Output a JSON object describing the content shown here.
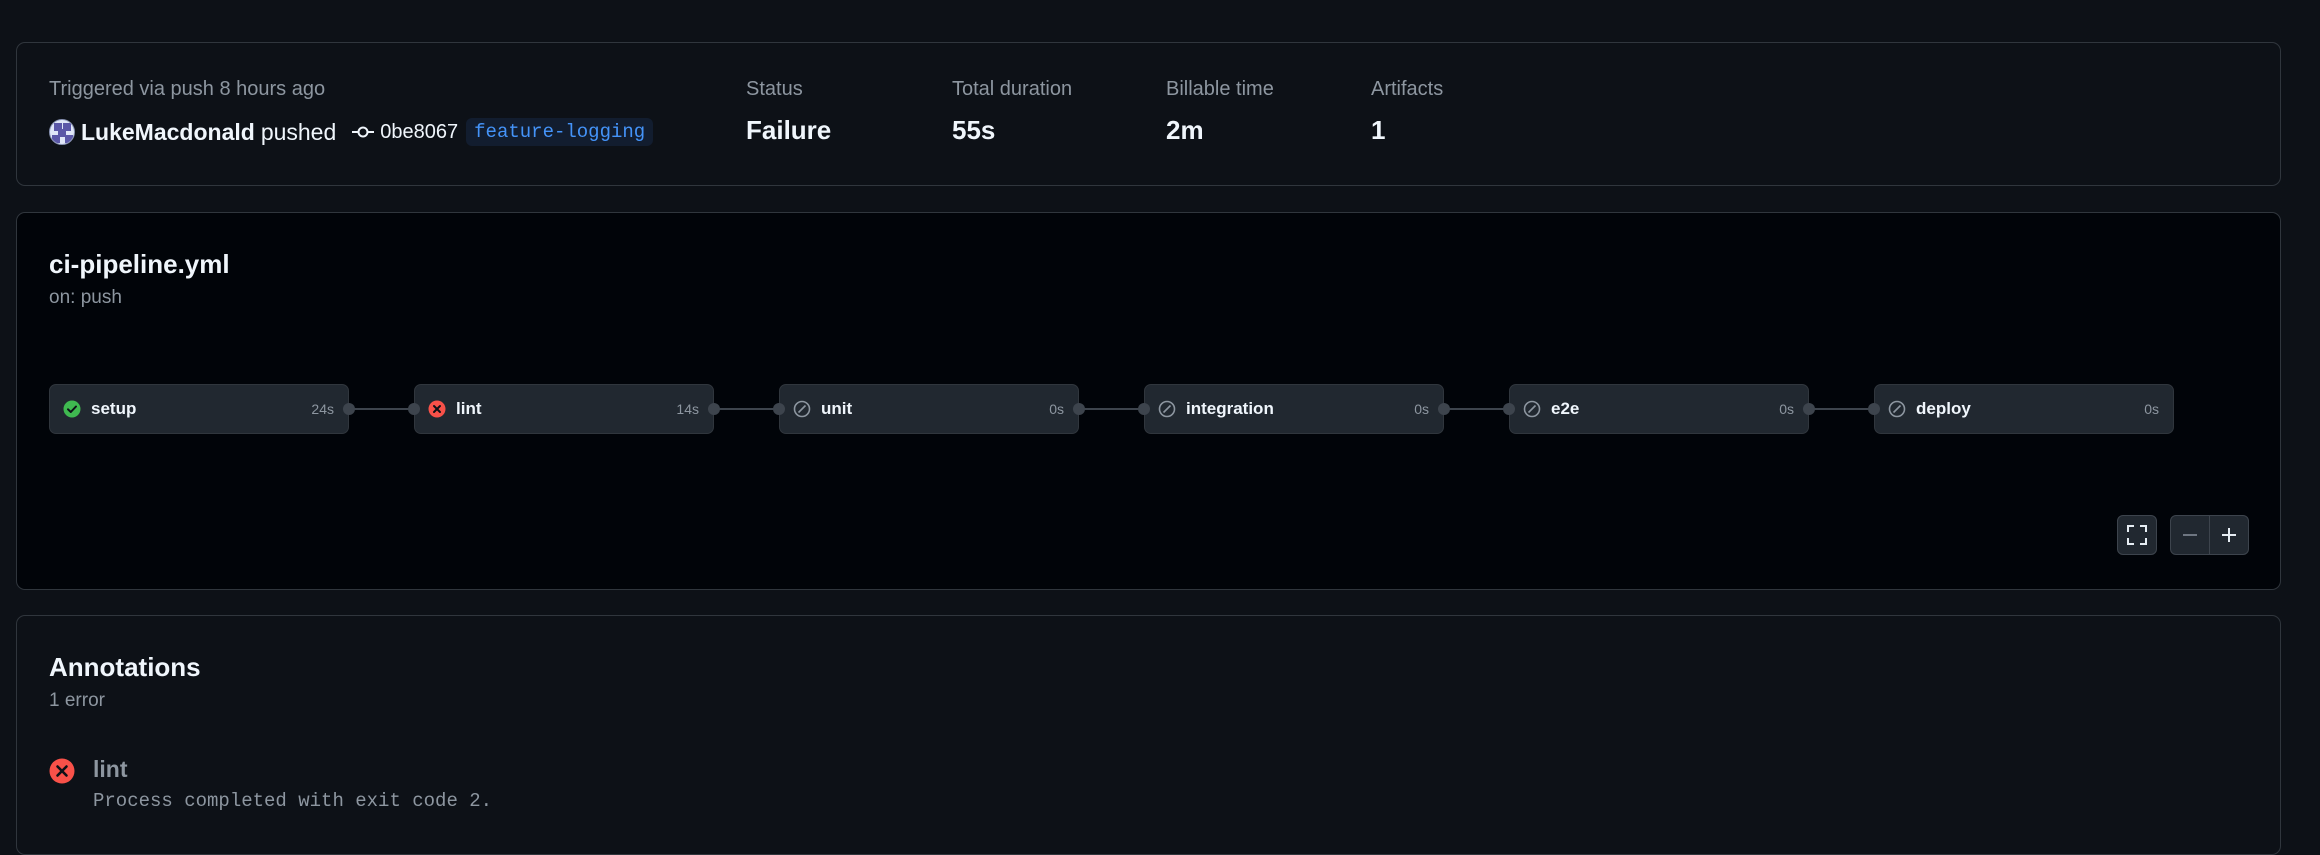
{
  "summary": {
    "trigger_text": "Triggered via push 8 hours ago",
    "user": "LukeMacdonald",
    "action": "pushed",
    "commit_sha": "0be8067",
    "branch": "feature-logging",
    "status_label": "Status",
    "status_value": "Failure",
    "duration_label": "Total duration",
    "duration_value": "55s",
    "billable_label": "Billable time",
    "billable_value": "2m",
    "artifacts_label": "Artifacts",
    "artifacts_value": "1"
  },
  "workflow": {
    "file": "ci-pipeline.yml",
    "event": "on: push",
    "jobs": [
      {
        "name": "setup",
        "duration": "24s",
        "status": "success",
        "icon": "check-circle-icon"
      },
      {
        "name": "lint",
        "duration": "14s",
        "status": "failure",
        "icon": "x-circle-icon"
      },
      {
        "name": "unit",
        "duration": "0s",
        "status": "skipped",
        "icon": "skip-icon"
      },
      {
        "name": "integration",
        "duration": "0s",
        "status": "skipped",
        "icon": "skip-icon"
      },
      {
        "name": "e2e",
        "duration": "0s",
        "status": "skipped",
        "icon": "skip-icon"
      },
      {
        "name": "deploy",
        "duration": "0s",
        "status": "skipped",
        "icon": "skip-icon"
      }
    ],
    "controls": [
      "fullscreen-icon",
      "zoom-out-icon",
      "zoom-in-icon"
    ]
  },
  "annotations": {
    "title": "Annotations",
    "count": "1 error",
    "items": [
      {
        "job": "lint",
        "message": "Process completed with exit code 2.",
        "icon": "x-circle-icon"
      }
    ]
  },
  "colors": {
    "success": "#3fb950",
    "failure": "#f85149",
    "skipped": "#8d96a0",
    "branch": "#4493f8"
  }
}
